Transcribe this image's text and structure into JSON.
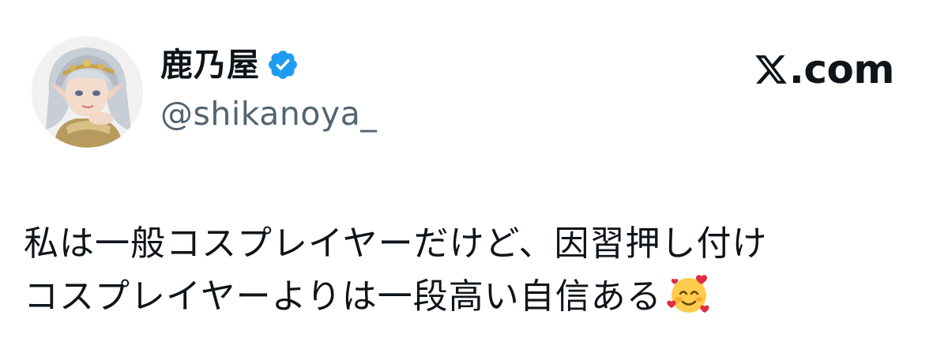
{
  "post": {
    "author": {
      "display_name": "鹿乃屋",
      "handle": "@shikanoya_",
      "avatar": "avatar-photo",
      "verified_icon": "verified-badge-icon",
      "verified_color": "#1d9bf0"
    },
    "brand": {
      "icon": "x-logo-icon",
      "text": ".com"
    },
    "text_lines": [
      "私は一般コスプレイヤーだけど、因習押し付け",
      "コスプレイヤーよりは一段高い自信ある"
    ],
    "emoji": "smiling-face-with-hearts-icon"
  },
  "colors": {
    "text": "#0f1419",
    "secondary_text": "#536471",
    "accent": "#1d9bf0",
    "background": "#ffffff"
  }
}
